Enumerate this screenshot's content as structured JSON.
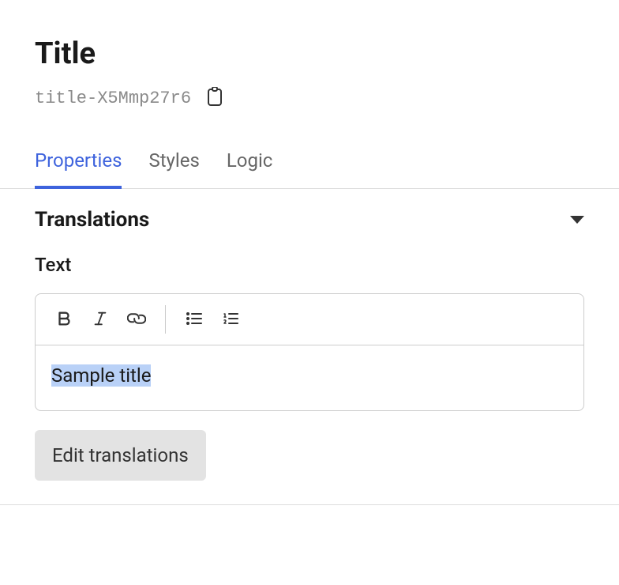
{
  "header": {
    "title": "Title",
    "componentId": "title-X5Mmp27r6"
  },
  "tabs": {
    "items": [
      {
        "label": "Properties",
        "active": true
      },
      {
        "label": "Styles",
        "active": false
      },
      {
        "label": "Logic",
        "active": false
      }
    ]
  },
  "section": {
    "title": "Translations",
    "expanded": true
  },
  "textField": {
    "label": "Text",
    "content": "Sample title"
  },
  "actions": {
    "editTranslations": "Edit translations"
  }
}
